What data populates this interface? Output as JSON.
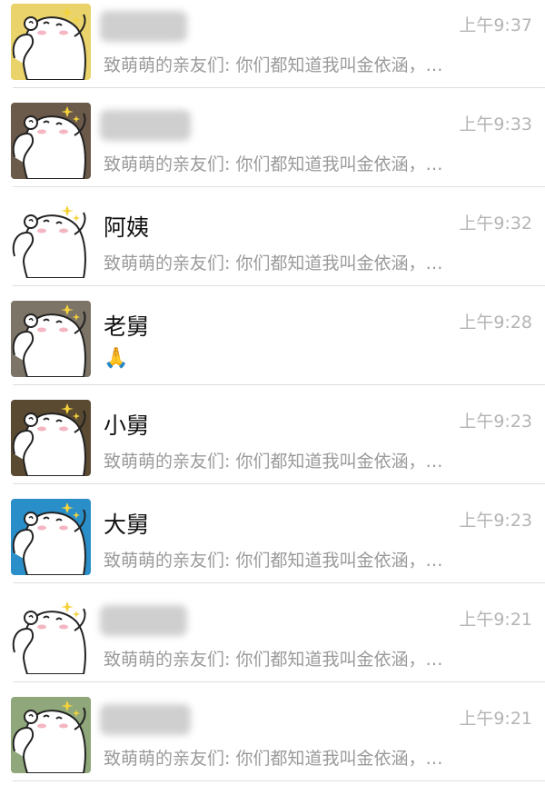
{
  "chats": [
    {
      "name": "",
      "name_blurred": true,
      "time": "上午9:37",
      "preview": "致萌萌的亲友们: 你们都知道我叫金依涵，…",
      "avatar_bg": "#e9d36a"
    },
    {
      "name": "",
      "name_blurred": true,
      "time": "上午9:33",
      "preview": "致萌萌的亲友们: 你们都知道我叫金依涵，…",
      "avatar_bg": "#6b5a4a"
    },
    {
      "name": "阿姨",
      "name_blurred": false,
      "time": "上午9:32",
      "preview": "致萌萌的亲友们: 你们都知道我叫金依涵，…",
      "avatar_bg": "#ffffff"
    },
    {
      "name": "老舅",
      "name_blurred": false,
      "time": "上午9:28",
      "preview": "🙏",
      "avatar_bg": "#7d7468"
    },
    {
      "name": "小舅",
      "name_blurred": false,
      "time": "上午9:23",
      "preview": "致萌萌的亲友们: 你们都知道我叫金依涵，…",
      "avatar_bg": "#5a4a32"
    },
    {
      "name": "大舅",
      "name_blurred": false,
      "time": "上午9:23",
      "preview": "致萌萌的亲友们: 你们都知道我叫金依涵，…",
      "avatar_bg": "#2a8fc9"
    },
    {
      "name": "",
      "name_blurred": true,
      "time": "上午9:21",
      "preview": "致萌萌的亲友们: 你们都知道我叫金依涵，…",
      "avatar_bg": "#ffffff"
    },
    {
      "name": "",
      "name_blurred": true,
      "time": "上午9:21",
      "preview": "致萌萌的亲友们: 你们都知道我叫金依涵，…",
      "avatar_bg": "#8fa77a"
    }
  ],
  "icons": {
    "avatar": "cartoon-mouse-avatar",
    "sparkle": "sparkle-icon"
  },
  "colors": {
    "name_text": "#111111",
    "preview_text": "#9a9a9a",
    "time_text": "#b4b4b4",
    "divider": "#dedede",
    "blur_patch": "#cfcfcf"
  }
}
